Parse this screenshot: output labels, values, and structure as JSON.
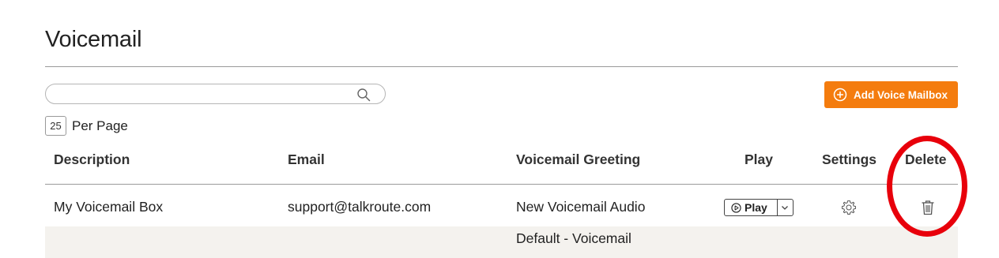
{
  "page": {
    "title": "Voicemail"
  },
  "search": {
    "value": "",
    "placeholder": ""
  },
  "toolbar": {
    "add_label": "Add Voice Mailbox"
  },
  "pagination": {
    "per_page_value": "25",
    "per_page_label": "Per Page"
  },
  "table": {
    "columns": [
      "Description",
      "Email",
      "Voicemail Greeting",
      "Play",
      "Settings",
      "Delete"
    ],
    "rows": [
      {
        "description": "My Voicemail Box",
        "email": "support@talkroute.com",
        "greeting": "New Voicemail Audio",
        "play_label": "Play"
      },
      {
        "description": "",
        "email": "",
        "greeting": "Default - Voicemail",
        "play_label": ""
      }
    ]
  },
  "colors": {
    "accent": "#f47c0e",
    "annotation": "#e8000b",
    "alt_row": "#f4f2ee"
  },
  "icons": [
    "search-icon",
    "plus-circle-icon",
    "play-circle-icon",
    "chevron-down-icon",
    "gear-icon",
    "trash-icon"
  ]
}
